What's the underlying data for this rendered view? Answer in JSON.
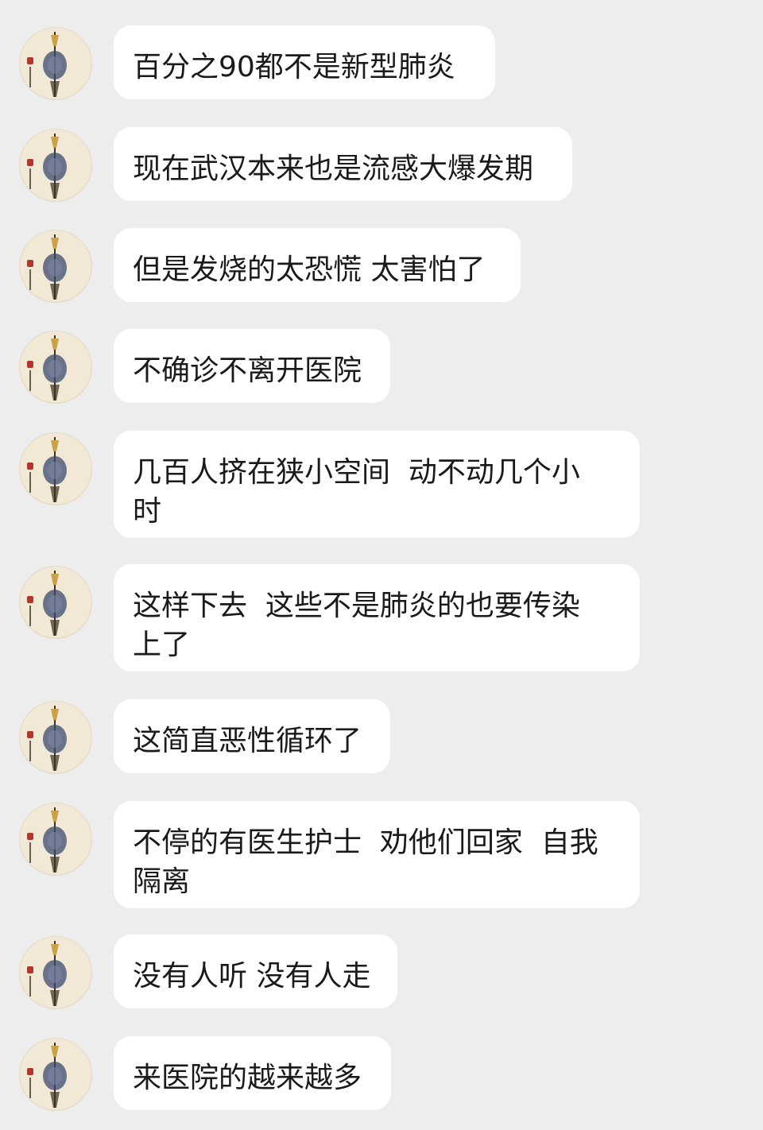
{
  "chat": {
    "messages": [
      {
        "text": "百分之90都不是新型肺炎"
      },
      {
        "text": "现在武汉本来也是流感大爆发期"
      },
      {
        "text": "但是发烧的太恐慌 太害怕了"
      },
      {
        "text": "不确诊不离开医院"
      },
      {
        "text": "几百人挤在狭小空间  动不动几个小\n时"
      },
      {
        "text": "这样下去  这些不是肺炎的也要传染\n上了"
      },
      {
        "text": "这简直恶性循环了"
      },
      {
        "text": "不停的有医生护士  劝他们回家  自我\n隔离"
      },
      {
        "text": "没有人听 没有人走"
      },
      {
        "text": "来医院的越来越多"
      }
    ]
  },
  "colors": {
    "background": "#ededed",
    "bubble": "#ffffff",
    "text": "#1a1a1a",
    "avatar_bg": "#f1e9d6",
    "seal_red": "#b1362d",
    "emblem_blue": "#3b4a6b",
    "figure_gold": "#c9a24a",
    "figure_dark": "#3a2f22"
  },
  "icons": {
    "avatar": "avatar-icon"
  }
}
